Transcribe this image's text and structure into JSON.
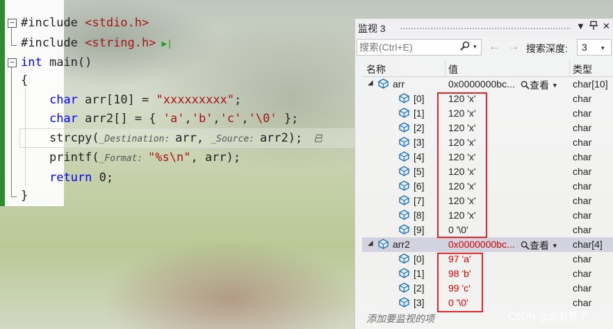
{
  "editor": {
    "lines": [
      {
        "parts": [
          {
            "t": "#include ",
            "c": "plain"
          },
          {
            "t": "<stdio.h>",
            "c": "str"
          }
        ]
      },
      {
        "parts": [
          {
            "t": "#include ",
            "c": "plain"
          },
          {
            "t": "<string.h>",
            "c": "str"
          }
        ]
      },
      {
        "parts": [
          {
            "t": "int",
            "c": "kw"
          },
          {
            "t": " main()",
            "c": "plain"
          }
        ]
      },
      {
        "parts": [
          {
            "t": "{",
            "c": "plain"
          }
        ]
      },
      {
        "parts": [
          {
            "t": "    ",
            "c": "plain"
          },
          {
            "t": "char",
            "c": "kw"
          },
          {
            "t": " arr[10] = ",
            "c": "plain"
          },
          {
            "t": "\"xxxxxxxxx\"",
            "c": "str"
          },
          {
            "t": ";",
            "c": "plain"
          }
        ]
      },
      {
        "parts": [
          {
            "t": "    ",
            "c": "plain"
          },
          {
            "t": "char",
            "c": "kw"
          },
          {
            "t": " arr2[] = { ",
            "c": "plain"
          },
          {
            "t": "'a'",
            "c": "str"
          },
          {
            "t": ",",
            "c": "plain"
          },
          {
            "t": "'b'",
            "c": "str"
          },
          {
            "t": ",",
            "c": "plain"
          },
          {
            "t": "'c'",
            "c": "str"
          },
          {
            "t": ",",
            "c": "plain"
          },
          {
            "t": "'\\0'",
            "c": "str"
          },
          {
            "t": " };",
            "c": "plain"
          }
        ]
      },
      {
        "parts": [
          {
            "t": "    strcpy(",
            "c": "plain"
          },
          {
            "t": "_Destination: ",
            "c": "hint"
          },
          {
            "t": "arr, ",
            "c": "plain"
          },
          {
            "t": "_Source: ",
            "c": "hint"
          },
          {
            "t": "arr2);",
            "c": "plain"
          },
          {
            "t": "  已",
            "c": "hint"
          }
        ]
      },
      {
        "parts": [
          {
            "t": "    printf(",
            "c": "plain"
          },
          {
            "t": "_Format: ",
            "c": "hint"
          },
          {
            "t": "\"%s\\n\"",
            "c": "str"
          },
          {
            "t": ", arr);",
            "c": "plain"
          }
        ]
      },
      {
        "parts": [
          {
            "t": "    ",
            "c": "plain"
          },
          {
            "t": "return",
            "c": "kw"
          },
          {
            "t": " 0;",
            "c": "plain"
          }
        ]
      },
      {
        "parts": [
          {
            "t": "}",
            "c": "plain"
          }
        ]
      }
    ],
    "fold_minus": "−",
    "run_arrow": "▶|"
  },
  "watch": {
    "title": "监视 3",
    "title_icons": {
      "dropdown": "▼",
      "pin": "🖈",
      "close": "✕"
    },
    "search_placeholder": "搜索(Ctrl+E)",
    "search_icon": "🔍",
    "dropdown_glyph": "▾",
    "back_arrow": "←",
    "forward_arrow": "→",
    "depth_label": "搜索深度:",
    "depth_value": "3",
    "columns": {
      "name": "名称",
      "value": "值",
      "type": "类型"
    },
    "view_label": "查看",
    "view_icon": "🔍",
    "add_watch": "添加要监视的项",
    "rows": [
      {
        "name": "arr",
        "value": "0x0000000bc...",
        "type": "char[10]",
        "level": 0,
        "expander": "◢",
        "view": true,
        "changed": false,
        "selected": false
      },
      {
        "name": "[0]",
        "value": "120 'x'",
        "type": "char",
        "level": 1
      },
      {
        "name": "[1]",
        "value": "120 'x'",
        "type": "char",
        "level": 1
      },
      {
        "name": "[2]",
        "value": "120 'x'",
        "type": "char",
        "level": 1
      },
      {
        "name": "[3]",
        "value": "120 'x'",
        "type": "char",
        "level": 1
      },
      {
        "name": "[4]",
        "value": "120 'x'",
        "type": "char",
        "level": 1
      },
      {
        "name": "[5]",
        "value": "120 'x'",
        "type": "char",
        "level": 1
      },
      {
        "name": "[6]",
        "value": "120 'x'",
        "type": "char",
        "level": 1
      },
      {
        "name": "[7]",
        "value": "120 'x'",
        "type": "char",
        "level": 1
      },
      {
        "name": "[8]",
        "value": "120 'x'",
        "type": "char",
        "level": 1
      },
      {
        "name": "[9]",
        "value": "0 '\\0'",
        "type": "char",
        "level": 1
      },
      {
        "name": "arr2",
        "value": "0x0000000bc...",
        "type": "char[4]",
        "level": 0,
        "expander": "◢",
        "view": true,
        "changed": true,
        "selected": true
      },
      {
        "name": "[0]",
        "value": "97 'a'",
        "type": "char",
        "level": 1,
        "changed": true
      },
      {
        "name": "[1]",
        "value": "98 'b'",
        "type": "char",
        "level": 1,
        "changed": true
      },
      {
        "name": "[2]",
        "value": "99 'c'",
        "type": "char",
        "level": 1,
        "changed": true
      },
      {
        "name": "[3]",
        "value": "0 '\\0'",
        "type": "char",
        "level": 1,
        "changed": true
      }
    ]
  },
  "watermark": "CSDN @念君思宁",
  "colors": {
    "highlight_box": "#e0282a",
    "changed_value": "#d40000",
    "object_icon": "#1c6fb5"
  }
}
